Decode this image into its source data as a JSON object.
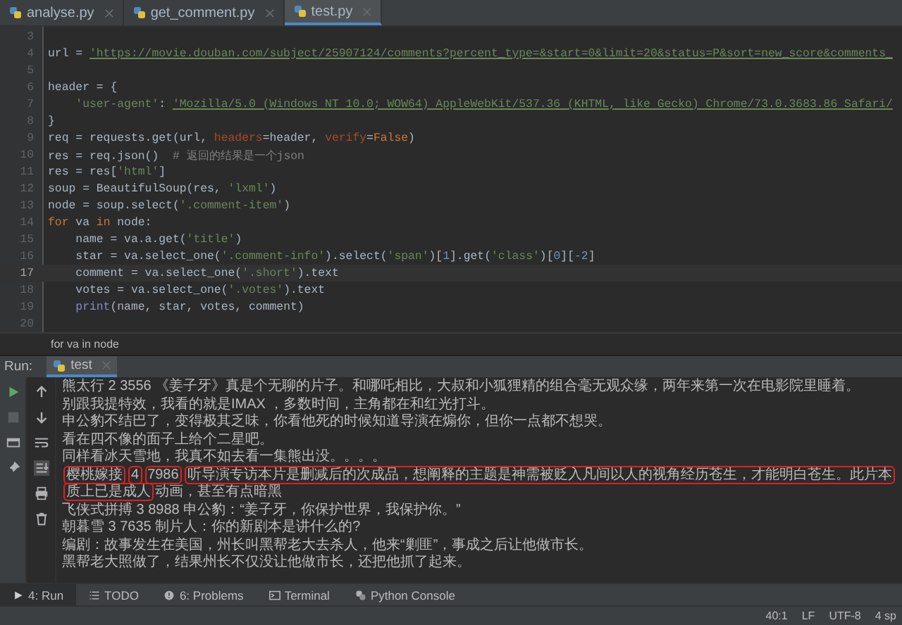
{
  "tabs": [
    {
      "label": "analyse.py",
      "selected": false
    },
    {
      "label": "get_comment.py",
      "selected": false
    },
    {
      "label": "test.py",
      "selected": true
    }
  ],
  "editor": {
    "lines": [
      {
        "num": "3",
        "current": false
      },
      {
        "num": "4",
        "current": false,
        "segs": [
          {
            "t": "url = ",
            "kind": "plain"
          },
          {
            "t": "'https://movie.douban.com/subject/25907124/comments?percent_type=&start=0&limit=20&status=P&sort=new_score&comments_",
            "kind": "link"
          }
        ]
      },
      {
        "num": "5",
        "current": false
      },
      {
        "num": "6",
        "current": false,
        "segs": [
          {
            "t": "header = {",
            "kind": "plain"
          }
        ]
      },
      {
        "num": "7",
        "current": false,
        "segs": [
          {
            "t": "    'user-agent'",
            "kind": "str"
          },
          {
            "t": ": ",
            "kind": "plain"
          },
          {
            "t": "'Mozilla/5.0 (Windows NT 10.0; WOW64) AppleWebKit/537.36 (KHTML, like Gecko) Chrome/73.0.3683.86 Safari/",
            "kind": "link"
          }
        ]
      },
      {
        "num": "8",
        "current": false,
        "segs": [
          {
            "t": "}",
            "kind": "plain"
          }
        ]
      },
      {
        "num": "9",
        "current": false,
        "segs": [
          {
            "t": "req = requests.get(url, ",
            "kind": "plain"
          },
          {
            "t": "headers",
            "kind": "param"
          },
          {
            "t": "=header, ",
            "kind": "plain"
          },
          {
            "t": "verify",
            "kind": "param"
          },
          {
            "t": "=",
            "kind": "plain"
          },
          {
            "t": "False",
            "kind": "kw"
          },
          {
            "t": ")",
            "kind": "plain"
          }
        ]
      },
      {
        "num": "10",
        "current": false,
        "segs": [
          {
            "t": "res = req.json()  ",
            "kind": "plain"
          },
          {
            "t": "# 返回的结果是一个json",
            "kind": "comment"
          }
        ]
      },
      {
        "num": "11",
        "current": false,
        "segs": [
          {
            "t": "res = res[",
            "kind": "plain"
          },
          {
            "t": "'html'",
            "kind": "str"
          },
          {
            "t": "]",
            "kind": "plain"
          }
        ]
      },
      {
        "num": "12",
        "current": false,
        "segs": [
          {
            "t": "soup = BeautifulSoup(res, ",
            "kind": "plain"
          },
          {
            "t": "'lxml'",
            "kind": "str"
          },
          {
            "t": ")",
            "kind": "plain"
          }
        ]
      },
      {
        "num": "13",
        "current": false,
        "segs": [
          {
            "t": "node = soup.select(",
            "kind": "plain"
          },
          {
            "t": "'.comment-item'",
            "kind": "str"
          },
          {
            "t": ")",
            "kind": "plain"
          }
        ]
      },
      {
        "num": "14",
        "current": false,
        "segs": [
          {
            "t": "for",
            "kind": "kw"
          },
          {
            "t": " va ",
            "kind": "plain"
          },
          {
            "t": "in",
            "kind": "kw"
          },
          {
            "t": " node:",
            "kind": "plain"
          }
        ]
      },
      {
        "num": "15",
        "current": false,
        "segs": [
          {
            "t": "    name = va.a.get(",
            "kind": "plain"
          },
          {
            "t": "'title'",
            "kind": "str"
          },
          {
            "t": ")",
            "kind": "plain"
          }
        ]
      },
      {
        "num": "16",
        "current": false,
        "segs": [
          {
            "t": "    star = va.select_one(",
            "kind": "plain"
          },
          {
            "t": "'.comment-info'",
            "kind": "str"
          },
          {
            "t": ").select(",
            "kind": "plain"
          },
          {
            "t": "'span'",
            "kind": "str"
          },
          {
            "t": ")[",
            "kind": "plain"
          },
          {
            "t": "1",
            "kind": "num"
          },
          {
            "t": "].get(",
            "kind": "plain"
          },
          {
            "t": "'class'",
            "kind": "str"
          },
          {
            "t": ")[",
            "kind": "plain"
          },
          {
            "t": "0",
            "kind": "num"
          },
          {
            "t": "][",
            "kind": "plain"
          },
          {
            "t": "-2",
            "kind": "num"
          },
          {
            "t": "]",
            "kind": "plain"
          }
        ]
      },
      {
        "num": "17",
        "current": true,
        "segs": [
          {
            "t": "    comment = va.select_one(",
            "kind": "plain"
          },
          {
            "t": "'.short'",
            "kind": "str"
          },
          {
            "t": ").text",
            "kind": "plain"
          }
        ]
      },
      {
        "num": "18",
        "current": false,
        "segs": [
          {
            "t": "    votes = va.select_one(",
            "kind": "plain"
          },
          {
            "t": "'.votes'",
            "kind": "str"
          },
          {
            "t": ").text",
            "kind": "plain"
          }
        ]
      },
      {
        "num": "19",
        "current": false,
        "segs": [
          {
            "t": "    print",
            "kind": "builtin"
          },
          {
            "t": "(name, star, votes, comment)",
            "kind": "plain"
          }
        ]
      },
      {
        "num": "20",
        "current": false
      }
    ],
    "breadcrumb": "for va in node"
  },
  "run": {
    "label": "Run:",
    "tab": "test",
    "output": [
      {
        "segs": [
          {
            "t": "熊太行 2 3556 《姜子牙》真是个无聊的片子。和哪吒相比，大叔和小狐狸精的组合毫无观众缘，两年来第一次在电影院里睡着。",
            "highlighted": false
          }
        ]
      },
      {
        "segs": [
          {
            "t": "别跟我提特效，我看的就是IMAX ，多数时间，主角都在和红光打斗。",
            "highlighted": false
          }
        ]
      },
      {
        "segs": [
          {
            "t": "申公豹不结巴了，变得极其乏味，你看他死的时候知道导演在煽你，但你一点都不想哭。",
            "highlighted": false
          }
        ]
      },
      {
        "segs": [
          {
            "t": "看在四不像的面子上给个二星吧。",
            "highlighted": false
          }
        ]
      },
      {
        "segs": [
          {
            "t": "同样看冰天雪地，我真不如去看一集熊出没。。。。",
            "highlighted": false
          }
        ]
      },
      {
        "segs": [
          {
            "t": "樱桃嫁接",
            "highlighted": true
          },
          {
            "t": "4",
            "highlighted": true
          },
          {
            "t": "7986",
            "highlighted": true
          },
          {
            "t": "听导演专访本片是删减后的次成品，想阐释的主题是神需被贬入凡间以人的视角经历苍生，才能明白苍生。此片本质上已是成人",
            "highlighted": true
          },
          {
            "t": "动画，甚至有点暗黑",
            "highlighted": false
          }
        ]
      },
      {
        "segs": [
          {
            "t": "飞侠式拼搏 3 8988 申公豹：“姜子牙，你保护世界，我保护你。”",
            "highlighted": false
          }
        ]
      },
      {
        "segs": [
          {
            "t": "朝暮雪 3 7635 制片人：你的新剧本是讲什么的?",
            "highlighted": false
          }
        ]
      },
      {
        "segs": [
          {
            "t": "编剧：故事发生在美国，州长叫黑帮老大去杀人，他来“剿匪”，事成之后让他做市长。",
            "highlighted": false
          }
        ]
      },
      {
        "segs": [
          {
            "t": "黑帮老大照做了，结果州长不仅没让他做市长，还把他抓了起来。",
            "highlighted": false
          }
        ]
      }
    ]
  },
  "toolwindows": [
    {
      "label": "4: Run",
      "kind": "run",
      "selected": true
    },
    {
      "label": "TODO",
      "kind": "todo",
      "selected": false
    },
    {
      "label": "6: Problems",
      "kind": "problems",
      "selected": false
    },
    {
      "label": "Terminal",
      "kind": "terminal",
      "selected": false
    },
    {
      "label": "Python Console",
      "kind": "console",
      "selected": false
    }
  ],
  "status_bar": [
    "40:1",
    "LF",
    "UTF-8",
    "4 sp"
  ]
}
